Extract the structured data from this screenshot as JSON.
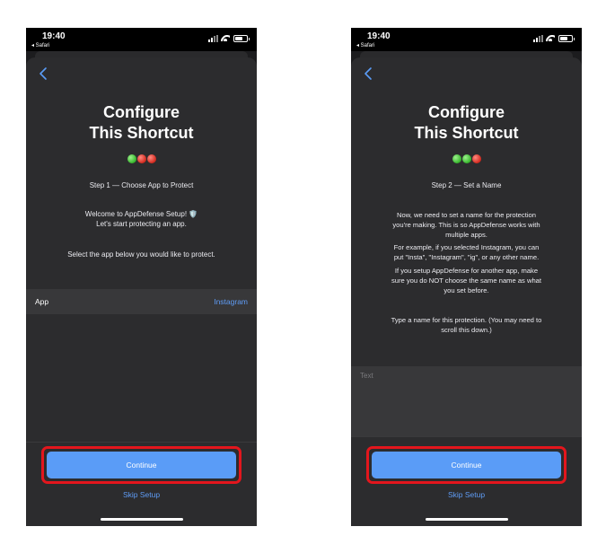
{
  "status_bar": {
    "time": "19:40",
    "back_app": "◂ Safari"
  },
  "shortcut": {
    "title_line1": "Configure",
    "title_line2": "This Shortcut"
  },
  "screen1": {
    "step": "Step 1 — Choose App to Protect",
    "welcome_line1": "Welcome to AppDefense Setup! 🛡️",
    "welcome_line2": "Let's start protecting an app.",
    "instruction": "Select the app below you would like to protect.",
    "app_label": "App",
    "app_value": "Instagram",
    "continue_label": "Continue",
    "skip_label": "Skip Setup",
    "progress_dots": [
      "green",
      "red",
      "red"
    ]
  },
  "screen2": {
    "step": "Step 2 — Set a Name",
    "para1_line1": "Now, we need to set a name for the protection",
    "para1_line2": "you're making. This is so AppDefense works with",
    "para1_line3": "multiple apps.",
    "para2_line1": "For example, if you selected Instagram, you can",
    "para2_line2": "put \"Insta\", \"Instagram\", \"ig\", or any other name.",
    "para3_line1": "If you setup AppDefense for another app, make",
    "para3_line2": "sure you do NOT choose the same name as what",
    "para3_line3": "you set before.",
    "para4_line1": "Type a name for this protection. (You may need to",
    "para4_line2": "scroll this down.)",
    "text_placeholder": "Text",
    "text_value": "",
    "continue_label": "Continue",
    "skip_label": "Skip Setup",
    "progress_dots": [
      "green",
      "green",
      "red"
    ]
  },
  "colors": {
    "accent_blue": "#5a9cf7",
    "link_blue": "#5f9cf5",
    "highlight_red": "#e3161d",
    "sheet_bg": "#2c2c2e"
  },
  "icons": {
    "back": "chevron-left-icon",
    "signal": "cellular-signal-icon",
    "wifi": "wifi-icon",
    "battery": "battery-icon"
  }
}
